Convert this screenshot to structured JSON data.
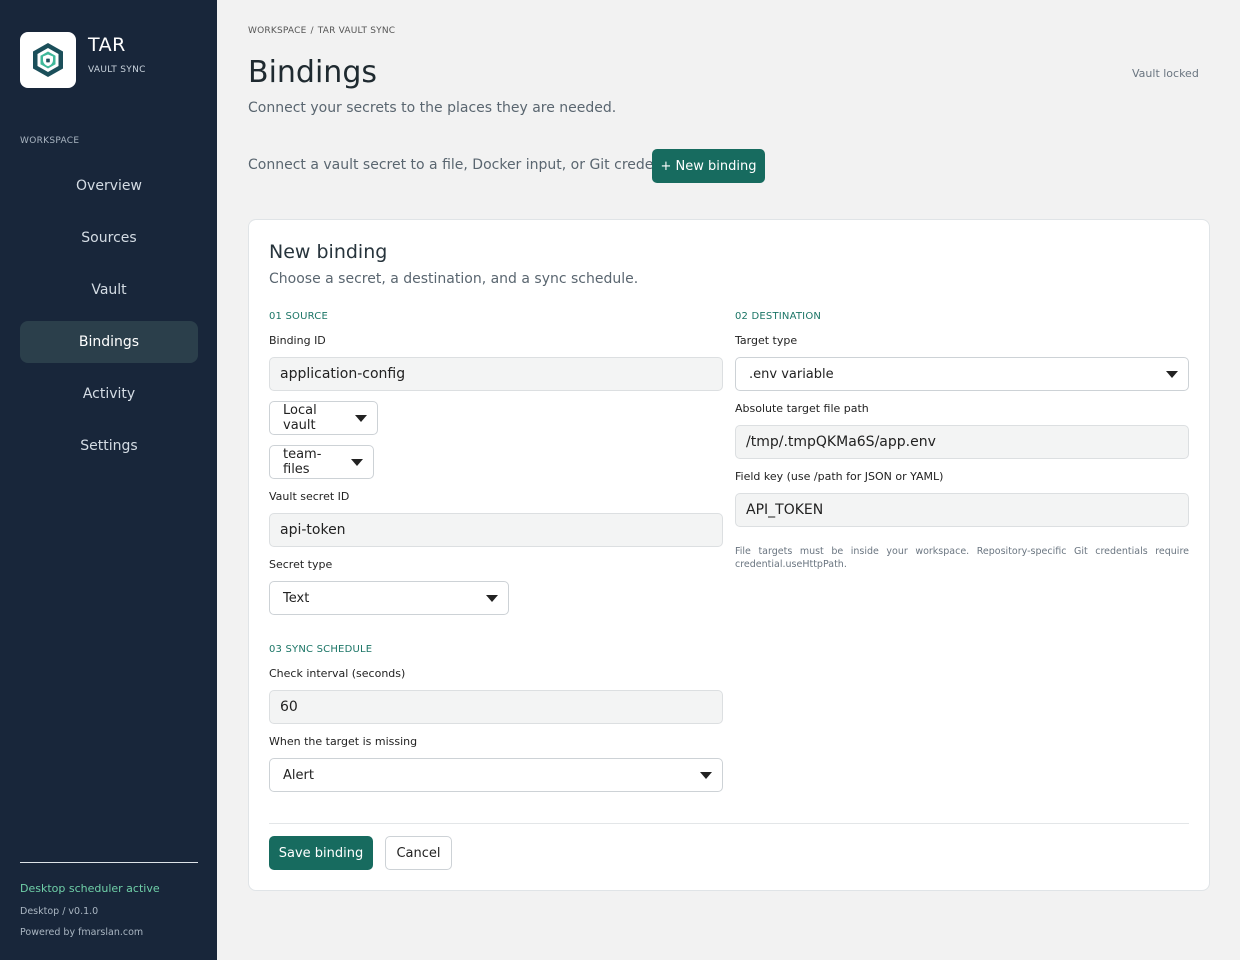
{
  "brand": {
    "name": "TAR",
    "subtitle": "VAULT SYNC",
    "logo_icon": "shield-lock-icon"
  },
  "sidebar": {
    "section_label": "WORKSPACE",
    "items": [
      {
        "label": "Overview",
        "active": false
      },
      {
        "label": "Sources",
        "active": false
      },
      {
        "label": "Vault",
        "active": false
      },
      {
        "label": "Bindings",
        "active": true
      },
      {
        "label": "Activity",
        "active": false
      },
      {
        "label": "Settings",
        "active": false
      }
    ],
    "scheduler_status": "Desktop scheduler active",
    "version": "Desktop  /  v0.1.0",
    "powered_by": "Powered by fmarslan.com"
  },
  "breadcrumb": {
    "root": "WORKSPACE",
    "separator": "/",
    "current": "TAR VAULT SYNC"
  },
  "header": {
    "title": "Bindings",
    "subtitle": "Connect your secrets to the places they are needed.",
    "vault_status": "Vault locked"
  },
  "intro": {
    "text": "Connect a vault secret to a file, Docker input, or Git credential.",
    "new_binding_label": "+ New binding"
  },
  "form": {
    "title": "New binding",
    "subtitle": "Choose a secret, a destination, and a sync schedule.",
    "source": {
      "step_label": "01  SOURCE",
      "binding_id_label": "Binding ID",
      "binding_id_value": "application-config",
      "vault_select": "Local vault",
      "collection_select": "team-files",
      "vault_secret_id_label": "Vault secret ID",
      "vault_secret_id_value": "api-token",
      "secret_type_label": "Secret type",
      "secret_type_value": "Text"
    },
    "destination": {
      "step_label": "02  DESTINATION",
      "target_type_label": "Target type",
      "target_type_value": ".env variable",
      "target_path_label": "Absolute target file path",
      "target_path_value": "/tmp/.tmpQKMa6S/app.env",
      "field_key_label": "Field key (use /path for JSON or YAML)",
      "field_key_value": "API_TOKEN",
      "note": "File targets must be inside your workspace. Repository-specific Git credentials require credential.useHttpPath."
    },
    "schedule": {
      "step_label": "03  SYNC SCHEDULE",
      "interval_label": "Check interval (seconds)",
      "interval_value": "60",
      "missing_label": "When the target is missing",
      "missing_value": "Alert"
    },
    "save_label": "Save binding",
    "cancel_label": "Cancel"
  },
  "colors": {
    "sidebar_bg": "#18263a",
    "accent": "#176b5f",
    "active_nav": "#2b3f4b",
    "scheduler_green": "#6fd0a8"
  }
}
